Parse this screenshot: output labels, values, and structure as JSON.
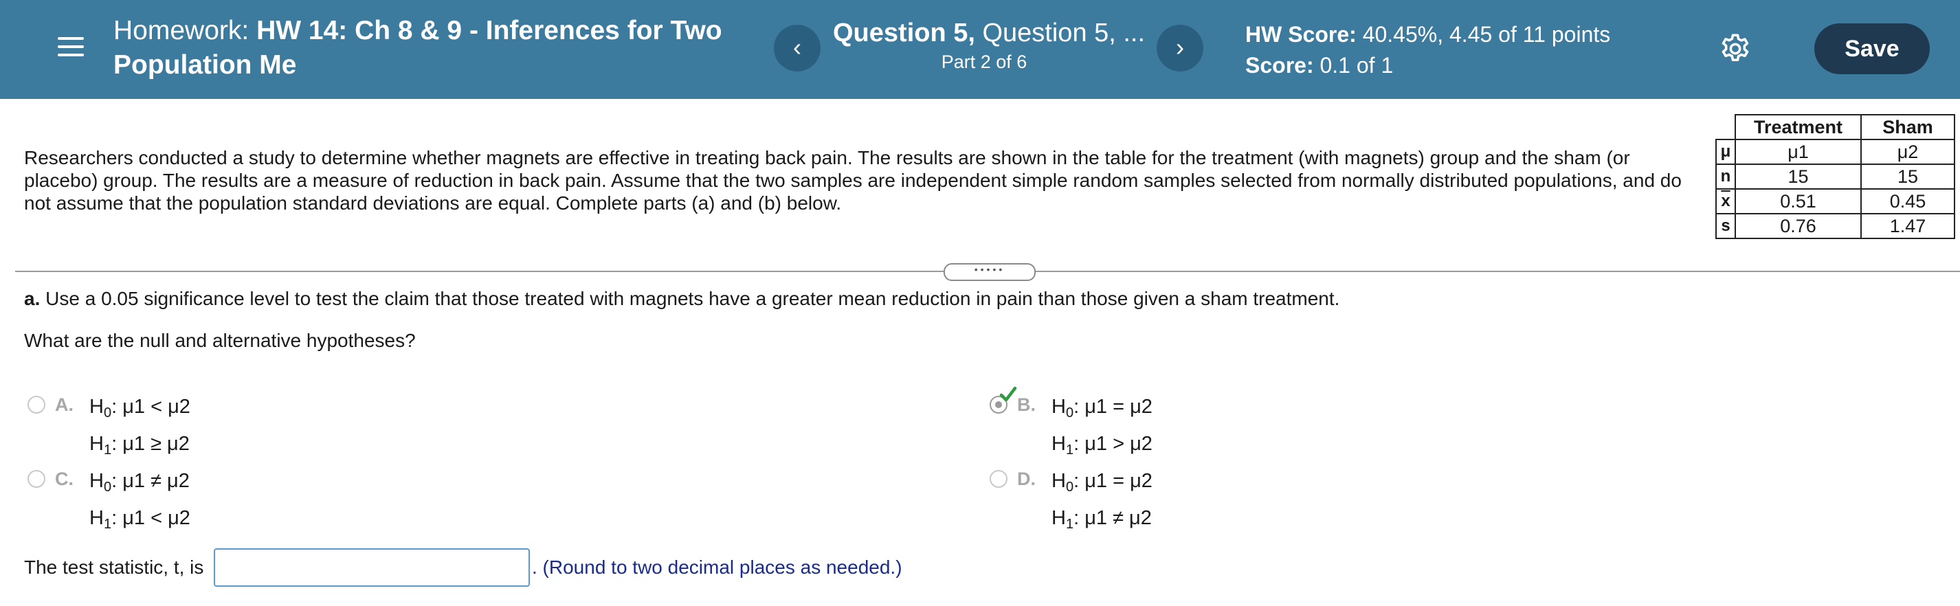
{
  "header": {
    "title_prefix": "Homework:",
    "title_main": "HW 14: Ch 8 & 9 - Inferences for Two Population Me",
    "question_bold": "Question 5,",
    "question_rest": " Question 5, ...",
    "part": "Part 2 of 6",
    "hw_score_label": "HW Score:",
    "hw_score_value": " 40.45%, 4.45 of 11 points",
    "score_label": "Score:",
    "score_value": " 0.1 of 1",
    "prev_icon": "chevron-left-icon",
    "next_icon": "chevron-right-icon",
    "save_label": "Save"
  },
  "problem": {
    "text": "Researchers conducted a study to determine whether magnets are effective in treating back pain. The results are shown in the table for the treatment (with magnets) group and the sham (or placebo) group. The results are a measure of reduction in back pain. Assume that the two samples are independent simple random samples selected from normally distributed populations, and do not assume that the population standard deviations are equal. Complete parts (a) and (b) below."
  },
  "table": {
    "headers": [
      "Treatment",
      "Sham"
    ],
    "rows": [
      {
        "label": "μ",
        "values": [
          "μ1",
          "μ2"
        ]
      },
      {
        "label": "n",
        "values": [
          "15",
          "15"
        ]
      },
      {
        "label": "x",
        "values": [
          "0.51",
          "0.45"
        ]
      },
      {
        "label": "s",
        "values": [
          "0.76",
          "1.47"
        ]
      }
    ]
  },
  "part_a": {
    "letter": "a.",
    "text": " Use a 0.05 significance level to test the claim that those treated with magnets have a greater mean reduction in pain than those given a sham treatment.",
    "question": "What are the null and alternative hypotheses?"
  },
  "options": [
    {
      "letter": "A.",
      "h0": ": μ1 < μ2",
      "h1": ": μ1 ≥ μ2",
      "selected": false
    },
    {
      "letter": "B.",
      "h0": ": μ1 = μ2",
      "h1": ": μ1 > μ2",
      "selected": true
    },
    {
      "letter": "C.",
      "h0": ": μ1 ≠ μ2",
      "h1": ": μ1 < μ2",
      "selected": false
    },
    {
      "letter": "D.",
      "h0": ": μ1 = μ2",
      "h1": ": μ1 ≠ μ2",
      "selected": false
    }
  ],
  "test_stat": {
    "label": "The test statistic, t, is",
    "value": "",
    "note": ". (Round to two decimal places as needed.)"
  },
  "colors": {
    "header_bg": "#3c7a9e",
    "save_bg": "#1f3a50",
    "check_green": "#2e9b3f",
    "input_border": "#5b9bd1",
    "note_text": "#1a2b8c"
  }
}
